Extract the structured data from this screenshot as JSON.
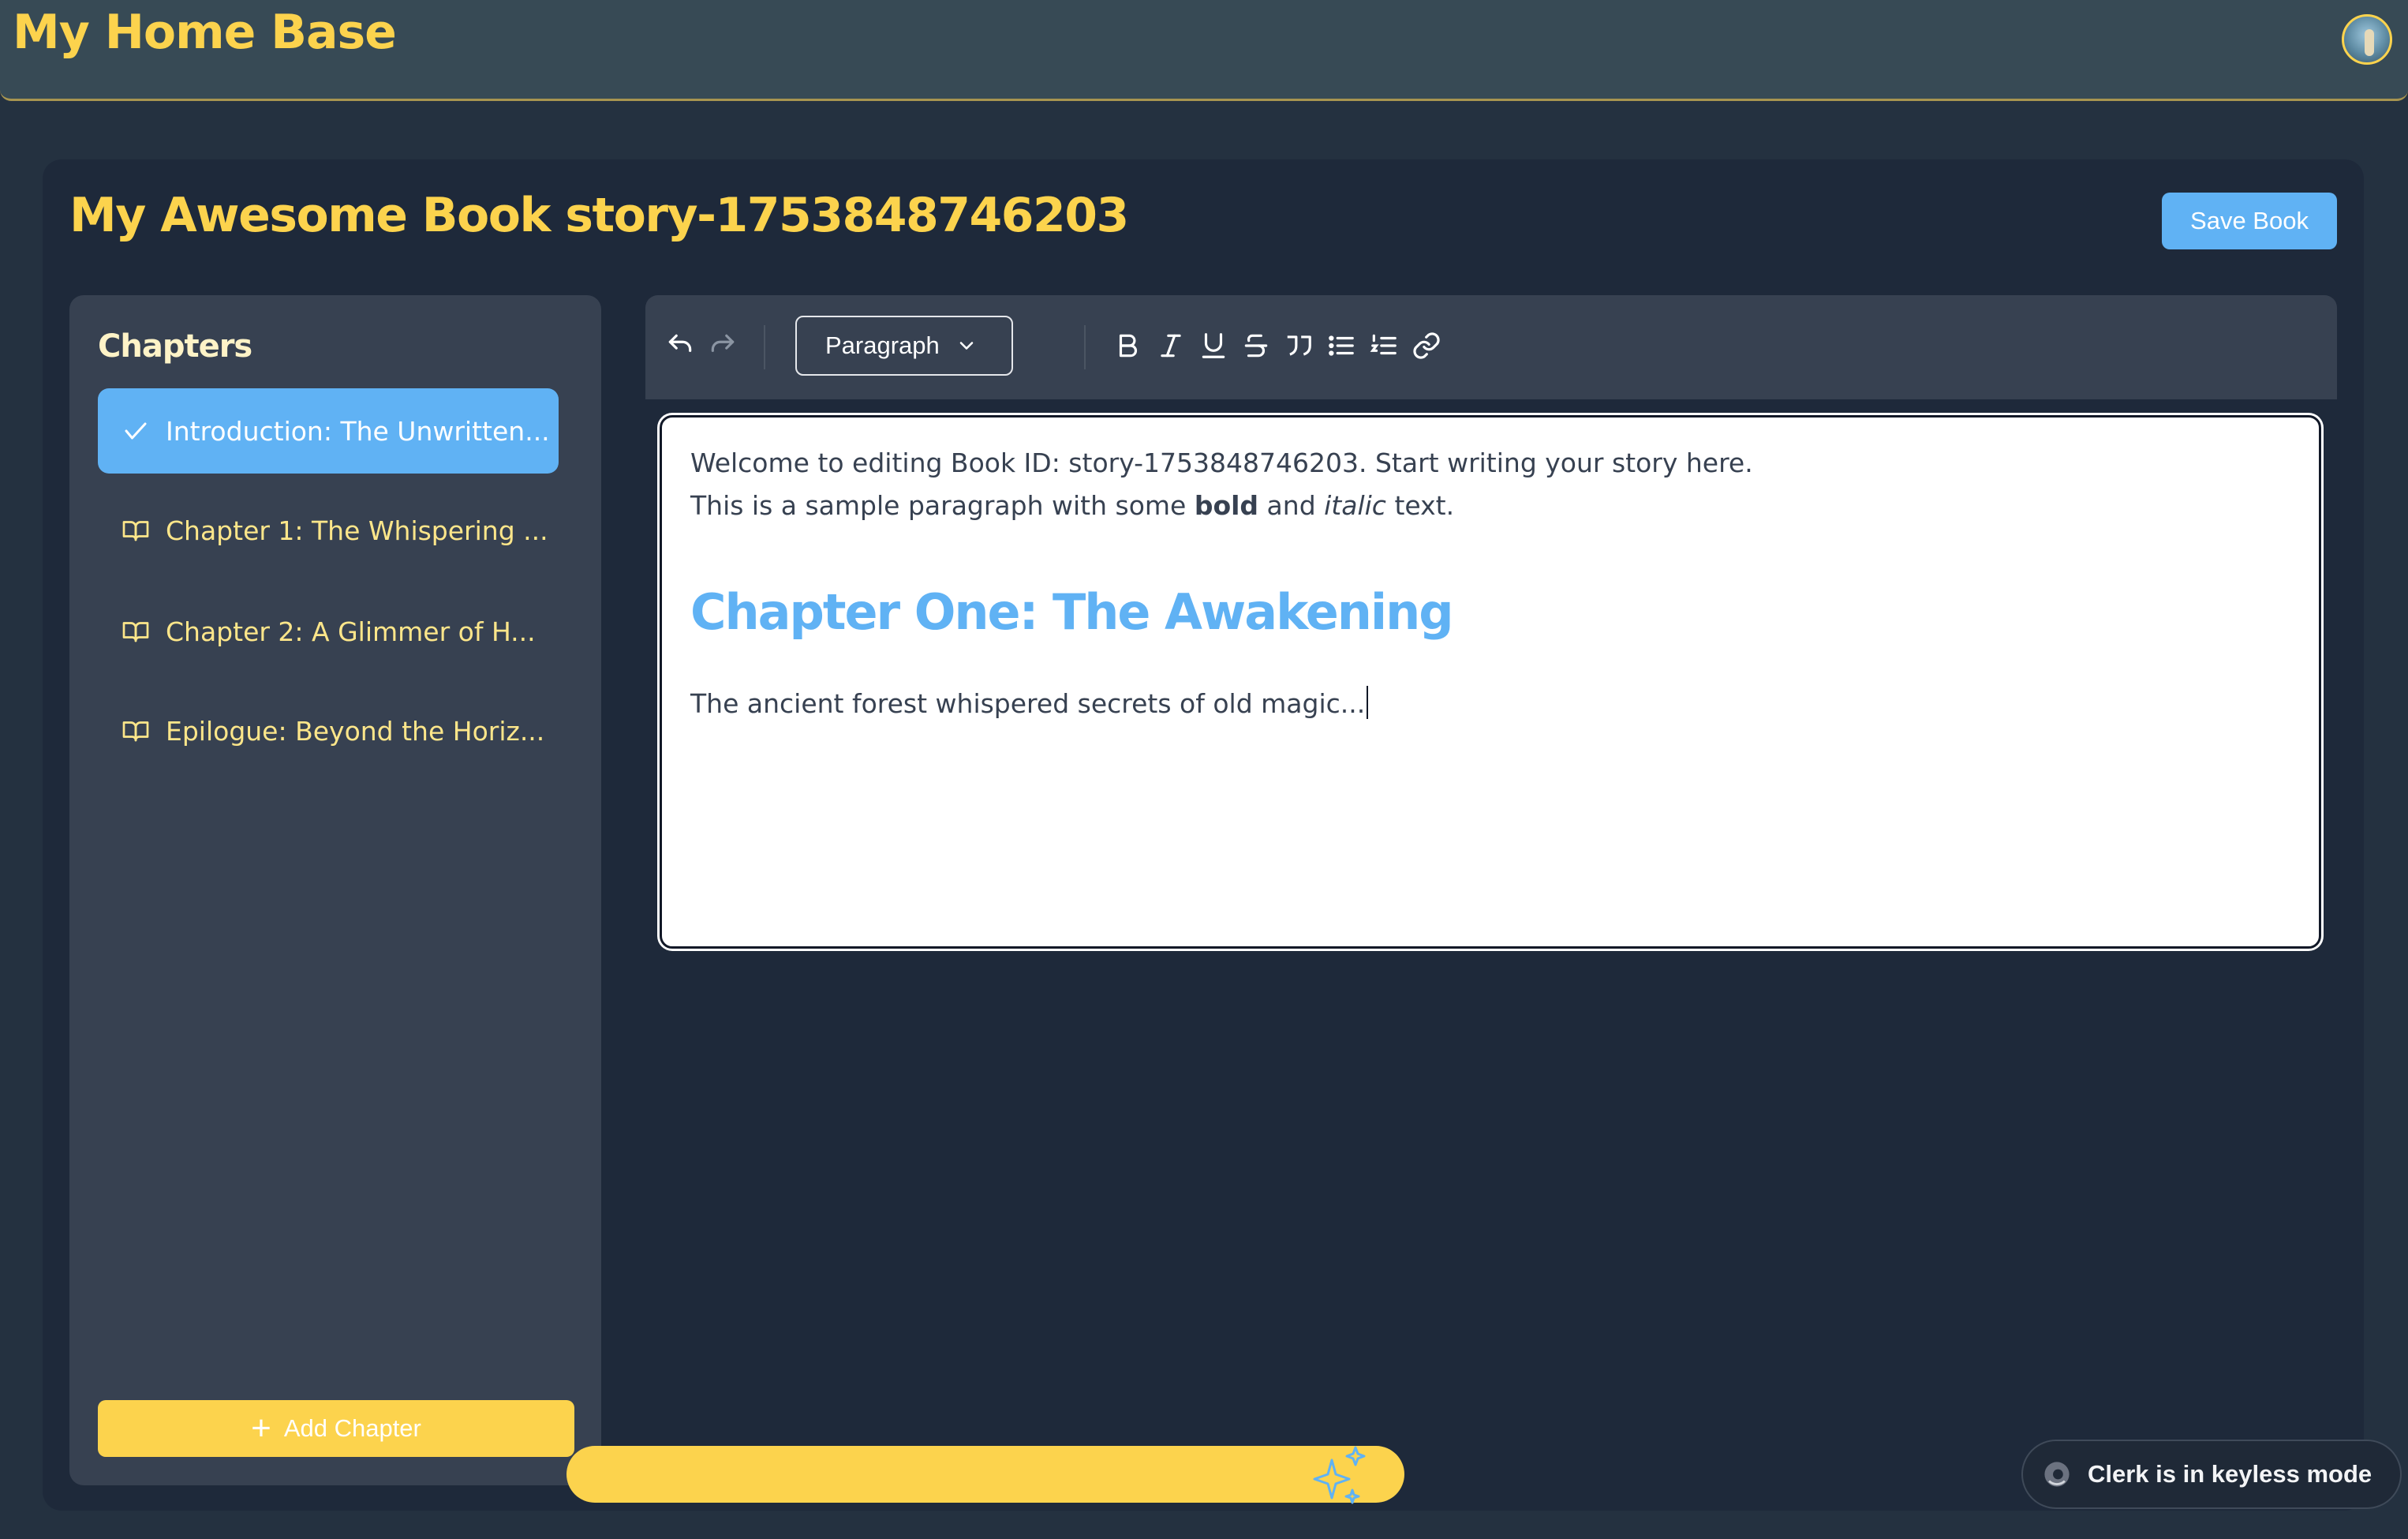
{
  "app": {
    "title": "My Home Base"
  },
  "editor": {
    "book_title": "My Awesome Book story-1753848746203",
    "save_label": "Save Book",
    "block_type": "Paragraph"
  },
  "sidebar": {
    "title": "Chapters",
    "items": [
      {
        "label": "Introduction: The Unwritten...",
        "active": true,
        "icon": "check-icon"
      },
      {
        "label": "Chapter 1: The Whispering ...",
        "active": false,
        "icon": "book-open-icon"
      },
      {
        "label": "Chapter 2: A Glimmer of H...",
        "active": false,
        "icon": "book-open-icon"
      },
      {
        "label": "Epilogue: Beyond the Horiz...",
        "active": false,
        "icon": "book-open-icon"
      }
    ],
    "add_label": "Add Chapter"
  },
  "document": {
    "line1": "Welcome to editing Book ID: story-1753848746203. Start writing your story here.",
    "line2_prefix": "This is a sample paragraph with some ",
    "line2_bold": "bold",
    "line2_mid": " and ",
    "line2_italic": "italic",
    "line2_suffix": " text.",
    "heading": "Chapter One: The Awakening",
    "line3": "The ancient forest whispered secrets of old magic..."
  },
  "toolbar": {
    "icons": [
      "undo-icon",
      "redo-icon",
      "bold-icon",
      "italic-icon",
      "underline-icon",
      "strikethrough-icon",
      "quote-icon",
      "bullet-list-icon",
      "ordered-list-icon",
      "link-icon"
    ]
  },
  "clerk": {
    "text": "Clerk is in keyless mode"
  },
  "colors": {
    "accent_yellow": "#fcd34d",
    "accent_blue": "#60b2f4",
    "background": "#243140",
    "panel": "#374151"
  }
}
